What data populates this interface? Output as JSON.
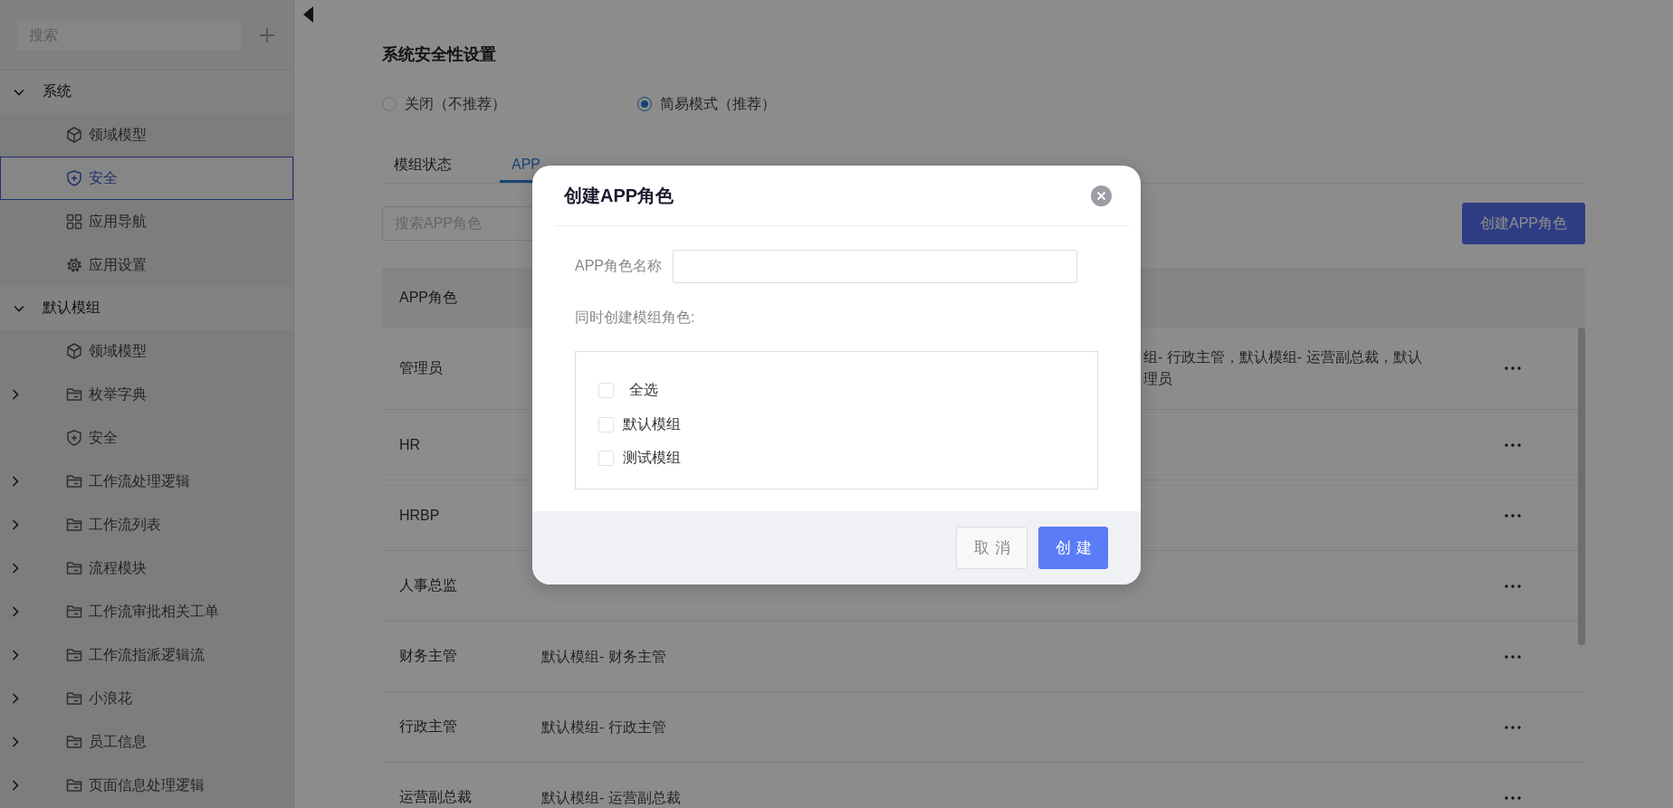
{
  "sidebar": {
    "search": {
      "placeholder": "搜索"
    },
    "groups": [
      {
        "label": "系统",
        "expanded": true,
        "children": [
          {
            "label": "领域模型",
            "kind": "model",
            "expandable": false,
            "selected": false
          },
          {
            "label": "安全",
            "kind": "security",
            "expandable": false,
            "selected": true
          },
          {
            "label": "应用导航",
            "kind": "navigation",
            "expandable": false,
            "selected": false
          },
          {
            "label": "应用设置",
            "kind": "settings",
            "expandable": false,
            "selected": false
          }
        ]
      },
      {
        "label": "默认模组",
        "expanded": true,
        "children": [
          {
            "label": "领域模型",
            "kind": "model",
            "expandable": false,
            "selected": false
          },
          {
            "label": "枚举字典",
            "kind": "folder",
            "expandable": true,
            "selected": false
          },
          {
            "label": "安全",
            "kind": "security",
            "expandable": false,
            "selected": false
          },
          {
            "label": "工作流处理逻辑",
            "kind": "folder",
            "expandable": true,
            "selected": false
          },
          {
            "label": "工作流列表",
            "kind": "folder",
            "expandable": true,
            "selected": false
          },
          {
            "label": "流程模块",
            "kind": "folder",
            "expandable": true,
            "selected": false
          },
          {
            "label": "工作流审批相关工单",
            "kind": "folder",
            "expandable": true,
            "selected": false
          },
          {
            "label": "工作流指派逻辑流",
            "kind": "folder",
            "expandable": true,
            "selected": false
          },
          {
            "label": "小浪花",
            "kind": "folder",
            "expandable": true,
            "selected": false
          },
          {
            "label": "员工信息",
            "kind": "folder",
            "expandable": true,
            "selected": false
          },
          {
            "label": "页面信息处理逻辑",
            "kind": "folder",
            "expandable": true,
            "selected": false
          }
        ]
      }
    ]
  },
  "main": {
    "title": "系统安全性设置",
    "modes": [
      {
        "label": "关闭（不推荐）",
        "selected": false
      },
      {
        "label": "简易模式（推荐）",
        "selected": true
      }
    ],
    "tabs": [
      {
        "label": "模组状态",
        "selected": false
      },
      {
        "label": "APP",
        "selected": true
      }
    ],
    "search": {
      "placeholder": "搜索APP角色"
    },
    "create_button": "创建APP角色",
    "table": {
      "columns": [
        "APP角色"
      ],
      "rows": [
        {
          "role": "管理员",
          "kind": "partial",
          "module_roles": [
            "组- 行政主管，默认模组- 运营副总裁，默认",
            "理员"
          ]
        },
        {
          "role": "HR"
        },
        {
          "role": "HRBP"
        },
        {
          "role": "人事总监"
        },
        {
          "role": "财务主管",
          "kind": "plain",
          "module_roles": [
            "默认模组- 财务主管"
          ]
        },
        {
          "role": "行政主管",
          "kind": "plain",
          "module_roles": [
            "默认模组- 行政主管"
          ]
        },
        {
          "role": "运营副总裁",
          "kind": "plain",
          "module_roles": [
            "默认模组- 运营副总裁"
          ]
        }
      ]
    }
  },
  "dialog": {
    "title": "创建APP角色",
    "name_label": "APP角色名称",
    "modules_label": "同时创建模组角色:",
    "modules": [
      {
        "label": "全选",
        "checked": false
      },
      {
        "label": "默认模组",
        "checked": false
      },
      {
        "label": "测试模组",
        "checked": false
      }
    ],
    "buttons": [
      {
        "label": "取消",
        "kind": "secondary"
      },
      {
        "label": "创建",
        "kind": "primary"
      }
    ]
  }
}
